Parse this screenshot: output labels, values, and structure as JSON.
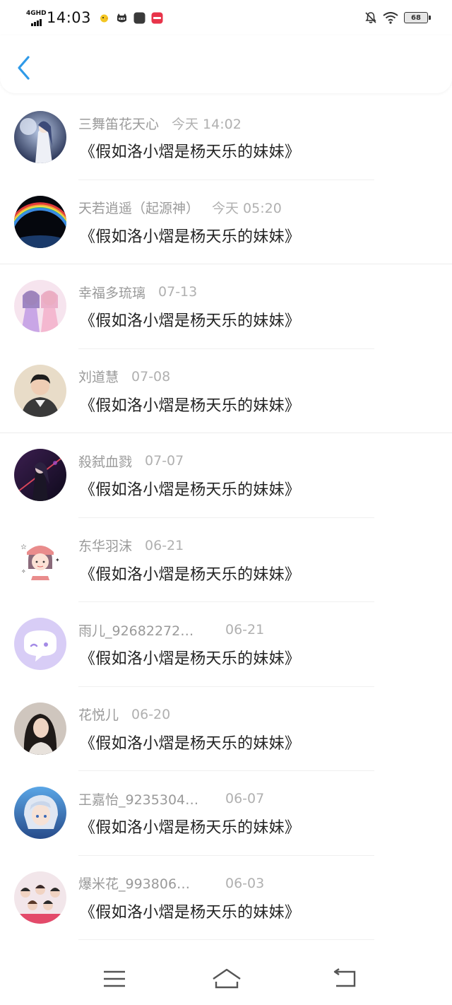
{
  "status_bar": {
    "network": "4GHD",
    "time": "14:03",
    "battery": "68",
    "icons": [
      "chick-app-icon",
      "cat-app-icon",
      "dark-app-icon",
      "red-app-icon",
      "bell-off-icon",
      "wifi-icon",
      "battery-icon"
    ]
  },
  "header": {
    "back_icon": "chevron-left-icon",
    "accent_color": "#2f9ae8"
  },
  "items": [
    {
      "name": "三舞笛花天心",
      "date": "今天 14:02",
      "book": "《假如洛小熠是杨天乐的妹妹》",
      "avatar": "anime-warrior-avatar"
    },
    {
      "name": "天若逍遥（起源神）",
      "date": "今天 05:20",
      "book": "《假如洛小熠是杨天乐的妹妹》",
      "avatar": "rainbow-earth-avatar"
    },
    {
      "name": "幸福多琉璃",
      "date": "07-13",
      "book": "《假如洛小熠是杨天乐的妹妹》",
      "avatar": "anime-girls-avatar"
    },
    {
      "name": "刘道慧",
      "date": "07-08",
      "book": "《假如洛小熠是杨天乐的妹妹》",
      "avatar": "young-man-avatar"
    },
    {
      "name": "殺弑血戮",
      "date": "07-07",
      "book": "《假如洛小熠是杨天乐的妹妹》",
      "avatar": "dark-warrior-avatar"
    },
    {
      "name": "东华羽沫",
      "date": "06-21",
      "book": "《假如洛小熠是杨天乐的妹妹》",
      "avatar": "cartoon-girl-avatar"
    },
    {
      "name": "雨儿_92682272…",
      "date": "06-21",
      "book": "《假如洛小熠是杨天乐的妹妹》",
      "avatar": "default-chat-avatar"
    },
    {
      "name": "花悦儿",
      "date": "06-20",
      "book": "《假如洛小熠是杨天乐的妹妹》",
      "avatar": "woman-portrait-avatar"
    },
    {
      "name": "王嘉怡_9235304…",
      "date": "06-07",
      "book": "《假如洛小熠是杨天乐的妹妹》",
      "avatar": "anime-boy-avatar"
    },
    {
      "name": "爆米花_993806…",
      "date": "06-03",
      "book": "《假如洛小熠是杨天乐的妹妹》",
      "avatar": "group-photo-avatar"
    }
  ],
  "bottom_nav": {
    "icons": [
      "menu-icon",
      "home-icon",
      "back-icon"
    ]
  }
}
